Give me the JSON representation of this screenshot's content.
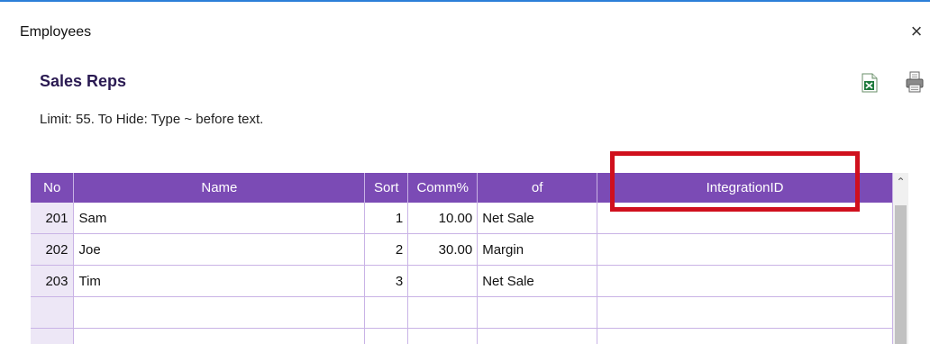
{
  "window": {
    "title": "Employees",
    "close_label": "×"
  },
  "section": {
    "title": "Sales Reps",
    "hint": "Limit: 55. To Hide: Type ~ before text."
  },
  "toolbar": {
    "excel_icon": "excel-export-icon",
    "print_icon": "print-icon"
  },
  "table": {
    "columns": [
      "No",
      "Name",
      "Sort",
      "Comm%",
      "of",
      "IntegrationID"
    ],
    "rows": [
      {
        "no": "201",
        "name": "Sam",
        "sort": "1",
        "comm": "10.00",
        "of": "Net Sale",
        "integration_id": ""
      },
      {
        "no": "202",
        "name": "Joe",
        "sort": "2",
        "comm": "30.00",
        "of": "Margin",
        "integration_id": ""
      },
      {
        "no": "203",
        "name": "Tim",
        "sort": "3",
        "comm": "",
        "of": "Net Sale",
        "integration_id": ""
      },
      {
        "no": "",
        "name": "",
        "sort": "",
        "comm": "",
        "of": "",
        "integration_id": ""
      },
      {
        "no": "",
        "name": "",
        "sort": "",
        "comm": "",
        "of": "",
        "integration_id": ""
      }
    ]
  },
  "colors": {
    "header_bg": "#7b4bb5",
    "highlight": "#d0101d",
    "title_color": "#2a1a52"
  }
}
